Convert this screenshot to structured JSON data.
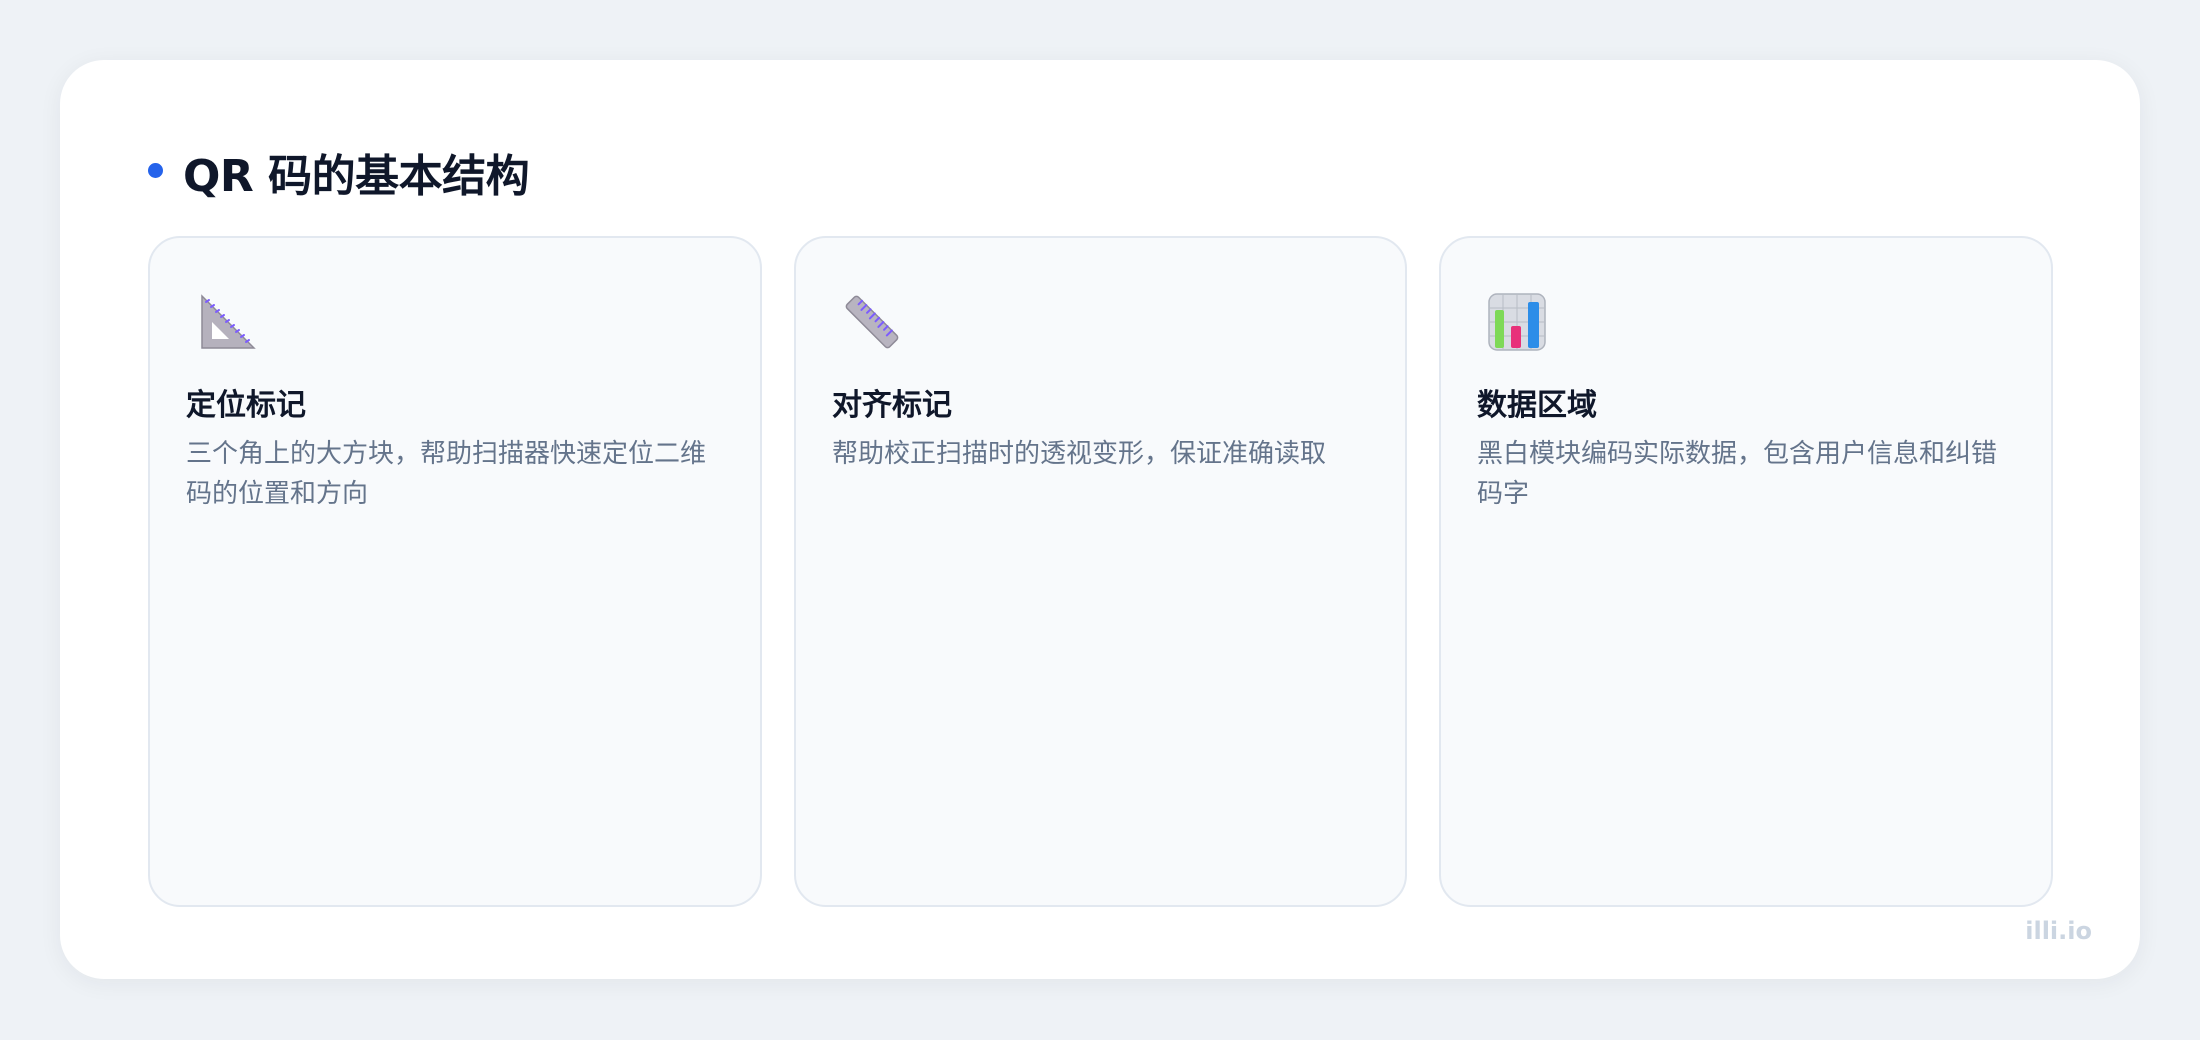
{
  "header": {
    "title": "QR 码的基本结构"
  },
  "cards": [
    {
      "icon": "triangular-ruler-icon",
      "title": "定位标记",
      "description": "三个角上的大方块，帮助扫描器快速定位二维码的位置和方向"
    },
    {
      "icon": "straight-ruler-icon",
      "title": "对齐标记",
      "description": "帮助校正扫描时的透视变形，保证准确读取"
    },
    {
      "icon": "bar-chart-icon",
      "title": "数据区域",
      "description": "黑白模块编码实际数据，包含用户信息和纠错码字"
    }
  ],
  "watermark": "illi.io",
  "colors": {
    "accent": "#2563eb",
    "background": "#eef2f6",
    "card": "#f8fafc"
  }
}
